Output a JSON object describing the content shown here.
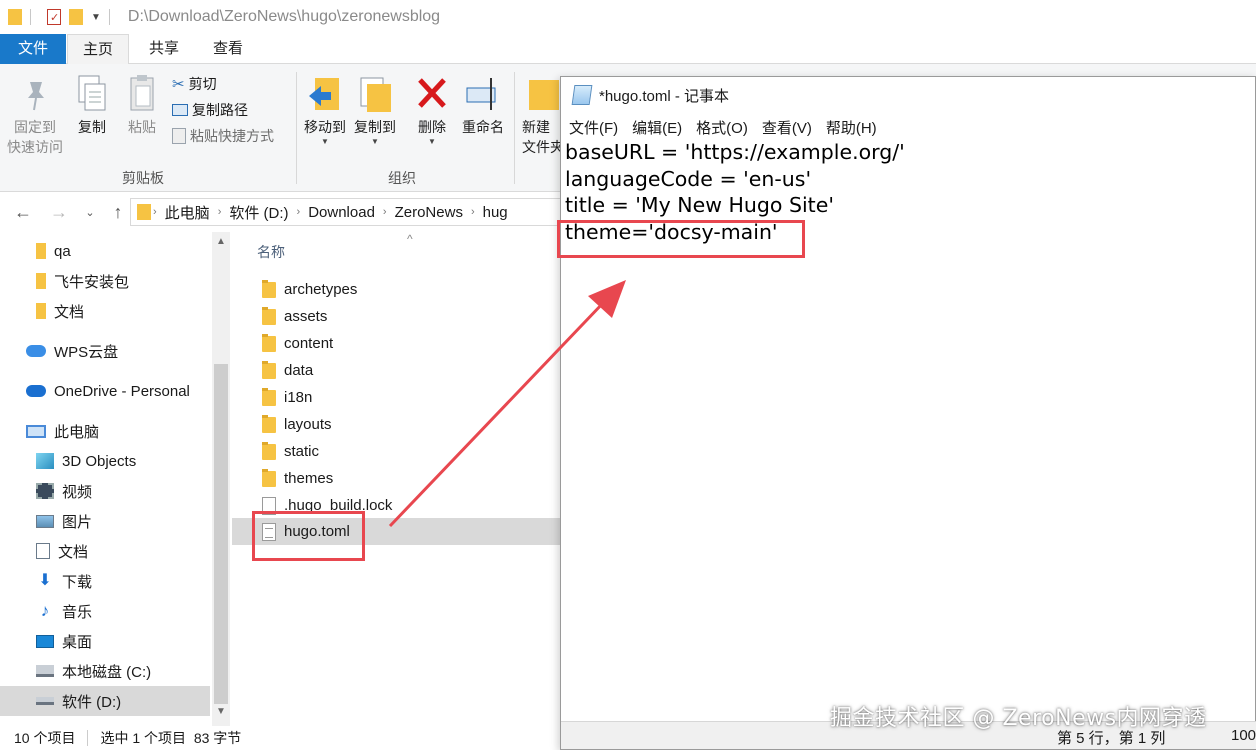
{
  "explorer": {
    "title_path": "D:\\Download\\ZeroNews\\hugo\\zeronewsblog",
    "tabs": [
      "文件",
      "主页",
      "共享",
      "查看"
    ],
    "ribbon": {
      "pin_label": "固定到\n快速访问",
      "copy_label": "复制",
      "paste_label": "粘贴",
      "cut_label": "剪切",
      "copy_path_label": "复制路径",
      "paste_shortcut_label": "粘贴快捷方式",
      "clipboard_group": "剪贴板",
      "move_to_label": "移动到",
      "copy_to_label": "复制到",
      "delete_label": "删除",
      "rename_label": "重命名",
      "organize_group": "组织",
      "new_folder_label": "新建\n文件夹"
    },
    "breadcrumb": [
      "此电脑",
      "软件 (D:)",
      "Download",
      "ZeroNews",
      "hug"
    ],
    "nav": [
      {
        "label": "qa",
        "icon": "folder-icon"
      },
      {
        "label": "飞牛安装包",
        "icon": "folder-icon"
      },
      {
        "label": "文档",
        "icon": "folder-icon"
      },
      {
        "label": "WPS云盘",
        "icon": "cloud-icon"
      },
      {
        "label": "OneDrive - Personal",
        "icon": "cloud-icon"
      },
      {
        "label": "此电脑",
        "icon": "pc-icon"
      },
      {
        "label": "3D Objects",
        "icon": "cube-icon"
      },
      {
        "label": "视频",
        "icon": "video-icon"
      },
      {
        "label": "图片",
        "icon": "picture-icon"
      },
      {
        "label": "文档",
        "icon": "document-icon"
      },
      {
        "label": "下载",
        "icon": "download-icon"
      },
      {
        "label": "音乐",
        "icon": "music-icon"
      },
      {
        "label": "桌面",
        "icon": "desktop-icon"
      },
      {
        "label": "本地磁盘 (C:)",
        "icon": "drive-icon"
      },
      {
        "label": "软件 (D:)",
        "icon": "drive-icon"
      }
    ],
    "column_header": "名称",
    "files": [
      {
        "name": "archetypes",
        "type": "folder"
      },
      {
        "name": "assets",
        "type": "folder"
      },
      {
        "name": "content",
        "type": "folder"
      },
      {
        "name": "data",
        "type": "folder"
      },
      {
        "name": "i18n",
        "type": "folder"
      },
      {
        "name": "layouts",
        "type": "folder"
      },
      {
        "name": "static",
        "type": "folder"
      },
      {
        "name": "themes",
        "type": "folder"
      },
      {
        "name": ".hugo_build.lock",
        "type": "file"
      },
      {
        "name": "hugo.toml",
        "type": "file"
      }
    ],
    "status": {
      "item_count": "10 个项目",
      "selection": "选中 1 个项目  83 字节"
    }
  },
  "notepad": {
    "title": "*hugo.toml - 记事本",
    "menu": [
      "文件(F)",
      "编辑(E)",
      "格式(O)",
      "查看(V)",
      "帮助(H)"
    ],
    "lines": [
      "baseURL = 'https://example.org/'",
      "languageCode = 'en-us'",
      "title = 'My New Hugo Site'",
      "theme='docsy-main'"
    ],
    "status_position": "第 5 行，第 1 列",
    "status_zoom": "100"
  },
  "watermark": "掘金技术社区 @ ZeroNews内网穿透",
  "colors": {
    "highlight": "#e8474f",
    "file_tab": "#1979ca",
    "folder": "#f6c343"
  }
}
